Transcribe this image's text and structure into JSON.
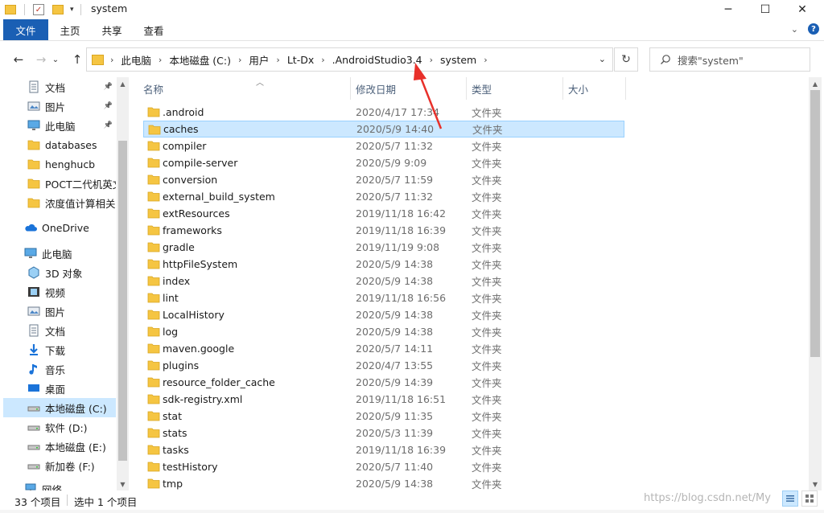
{
  "window": {
    "title": "system",
    "controls": {
      "minimize": "─",
      "maximize": "☐",
      "close": "✕"
    }
  },
  "ribbon": {
    "tabs": [
      "文件",
      "主页",
      "共享",
      "查看"
    ]
  },
  "nav": {
    "back": "←",
    "forward": "→",
    "recent": "⌄",
    "up": "↑"
  },
  "address": {
    "breadcrumbs": [
      "此电脑",
      "本地磁盘 (C:)",
      "用户",
      "Lt-Dx",
      ".AndroidStudio3.4",
      "system"
    ],
    "dropdown": "⌄",
    "refresh": "↻"
  },
  "search": {
    "placeholder": "搜索\"system\""
  },
  "sidebar": {
    "quick_access": [
      {
        "label": "文档",
        "icon": "documents-icon",
        "pinned": true
      },
      {
        "label": "图片",
        "icon": "pictures-icon",
        "pinned": true
      },
      {
        "label": "此电脑",
        "icon": "this-pc-icon",
        "pinned": true
      },
      {
        "label": "databases",
        "icon": "folder-icon",
        "pinned": false
      },
      {
        "label": "henghucb",
        "icon": "folder-icon",
        "pinned": false
      },
      {
        "label": "POCT二代机英文",
        "icon": "folder-icon",
        "pinned": false
      },
      {
        "label": "浓度值计算相关",
        "icon": "folder-icon",
        "pinned": false
      }
    ],
    "onedrive": {
      "label": "OneDrive",
      "icon": "onedrive-icon"
    },
    "this_pc": {
      "label": "此电脑",
      "icon": "this-pc-icon"
    },
    "pc_items": [
      {
        "label": "3D 对象",
        "icon": "3d-objects-icon"
      },
      {
        "label": "视频",
        "icon": "videos-icon"
      },
      {
        "label": "图片",
        "icon": "pictures-icon"
      },
      {
        "label": "文档",
        "icon": "documents-icon"
      },
      {
        "label": "下载",
        "icon": "downloads-icon"
      },
      {
        "label": "音乐",
        "icon": "music-icon"
      },
      {
        "label": "桌面",
        "icon": "desktop-icon"
      },
      {
        "label": "本地磁盘 (C:)",
        "icon": "drive-icon",
        "selected": true
      },
      {
        "label": "软件 (D:)",
        "icon": "drive-icon"
      },
      {
        "label": "本地磁盘 (E:)",
        "icon": "drive-icon"
      },
      {
        "label": "新加卷 (F:)",
        "icon": "drive-icon"
      }
    ],
    "network": {
      "label": "网络",
      "icon": "network-icon"
    }
  },
  "columns": {
    "name": "名称",
    "modified": "修改日期",
    "type": "类型",
    "size": "大小"
  },
  "files": [
    {
      "name": ".android",
      "modified": "2020/4/17 17:34",
      "type": "文件夹"
    },
    {
      "name": "caches",
      "modified": "2020/5/9 14:40",
      "type": "文件夹",
      "selected": true
    },
    {
      "name": "compiler",
      "modified": "2020/5/7 11:32",
      "type": "文件夹"
    },
    {
      "name": "compile-server",
      "modified": "2020/5/9 9:09",
      "type": "文件夹"
    },
    {
      "name": "conversion",
      "modified": "2020/5/7 11:59",
      "type": "文件夹"
    },
    {
      "name": "external_build_system",
      "modified": "2020/5/7 11:32",
      "type": "文件夹"
    },
    {
      "name": "extResources",
      "modified": "2019/11/18 16:42",
      "type": "文件夹"
    },
    {
      "name": "frameworks",
      "modified": "2019/11/18 16:39",
      "type": "文件夹"
    },
    {
      "name": "gradle",
      "modified": "2019/11/19 9:08",
      "type": "文件夹"
    },
    {
      "name": "httpFileSystem",
      "modified": "2020/5/9 14:38",
      "type": "文件夹"
    },
    {
      "name": "index",
      "modified": "2020/5/9 14:38",
      "type": "文件夹"
    },
    {
      "name": "lint",
      "modified": "2019/11/18 16:56",
      "type": "文件夹"
    },
    {
      "name": "LocalHistory",
      "modified": "2020/5/9 14:38",
      "type": "文件夹"
    },
    {
      "name": "log",
      "modified": "2020/5/9 14:38",
      "type": "文件夹"
    },
    {
      "name": "maven.google",
      "modified": "2020/5/7 14:11",
      "type": "文件夹"
    },
    {
      "name": "plugins",
      "modified": "2020/4/7 13:55",
      "type": "文件夹"
    },
    {
      "name": "resource_folder_cache",
      "modified": "2020/5/9 14:39",
      "type": "文件夹"
    },
    {
      "name": "sdk-registry.xml",
      "modified": "2019/11/18 16:51",
      "type": "文件夹"
    },
    {
      "name": "stat",
      "modified": "2020/5/9 11:35",
      "type": "文件夹"
    },
    {
      "name": "stats",
      "modified": "2020/5/3 11:39",
      "type": "文件夹"
    },
    {
      "name": "tasks",
      "modified": "2019/11/18 16:39",
      "type": "文件夹"
    },
    {
      "name": "testHistory",
      "modified": "2020/5/7 11:40",
      "type": "文件夹"
    },
    {
      "name": "tmp",
      "modified": "2020/5/9 14:38",
      "type": "文件夹"
    }
  ],
  "status": {
    "count": "33 个项目",
    "selection": "选中 1 个项目"
  },
  "watermark": "https://blog.csdn.net/My",
  "colors": {
    "accent": "#1a5fb4",
    "selection": "#cce8ff",
    "selection_border": "#99d1ff",
    "folder": "#f5c542",
    "annotation": "#e8302a"
  }
}
